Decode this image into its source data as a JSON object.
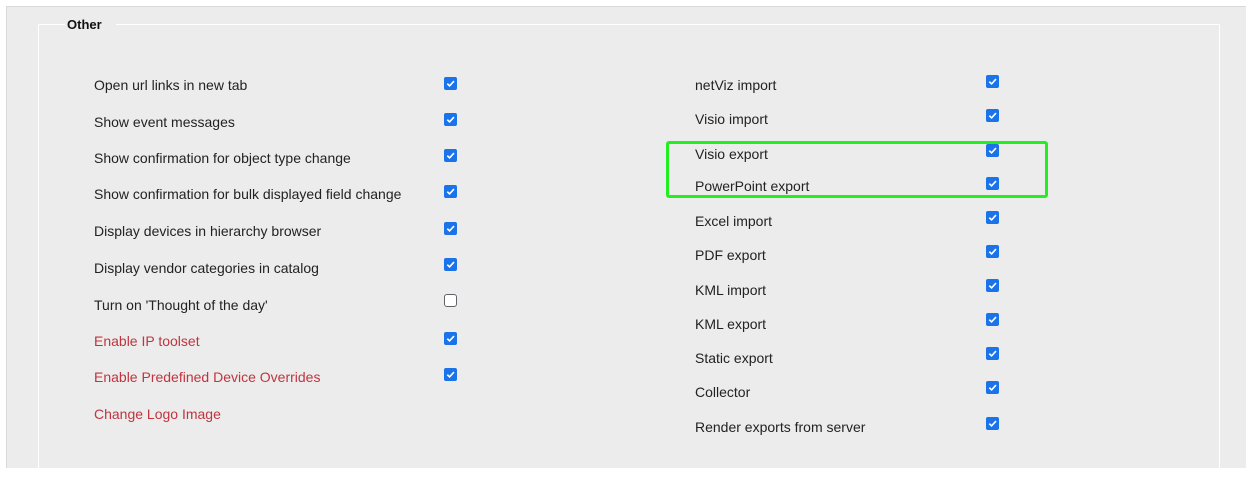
{
  "section": {
    "legend": "Other"
  },
  "left_options": [
    {
      "label": "Open url links in new tab",
      "checked": true,
      "style": "normal"
    },
    {
      "label": "Show event messages",
      "checked": true,
      "style": "normal"
    },
    {
      "label": "Show confirmation for object type change",
      "checked": true,
      "style": "normal"
    },
    {
      "label": "Show confirmation for bulk displayed field change",
      "checked": true,
      "style": "normal"
    },
    {
      "label": "Display devices in hierarchy browser",
      "checked": true,
      "style": "normal"
    },
    {
      "label": "Display vendor categories in catalog",
      "checked": true,
      "style": "normal"
    },
    {
      "label": "Turn on 'Thought of the day'",
      "checked": false,
      "style": "normal"
    },
    {
      "label": "Enable IP toolset",
      "checked": true,
      "style": "link"
    },
    {
      "label": "Enable Predefined Device Overrides",
      "checked": true,
      "style": "link"
    },
    {
      "label": "Change Logo Image",
      "style": "link"
    }
  ],
  "right_options": [
    {
      "label": "netViz import",
      "checked": true
    },
    {
      "label": "Visio import",
      "checked": true
    },
    {
      "label": "Visio export",
      "checked": true
    },
    {
      "label": "PowerPoint export",
      "checked": true
    },
    {
      "label": "Excel import",
      "checked": true
    },
    {
      "label": "PDF export",
      "checked": true
    },
    {
      "label": "KML import",
      "checked": true
    },
    {
      "label": "KML export",
      "checked": true
    },
    {
      "label": "Static export",
      "checked": true
    },
    {
      "label": "Collector",
      "checked": true
    },
    {
      "label": "Render exports from server",
      "checked": true
    }
  ],
  "colors": {
    "panel_bg": "#ececec",
    "checkbox_checked": "#1a73e8",
    "link_text": "#c0343f",
    "highlight_box": "#22ee22"
  }
}
